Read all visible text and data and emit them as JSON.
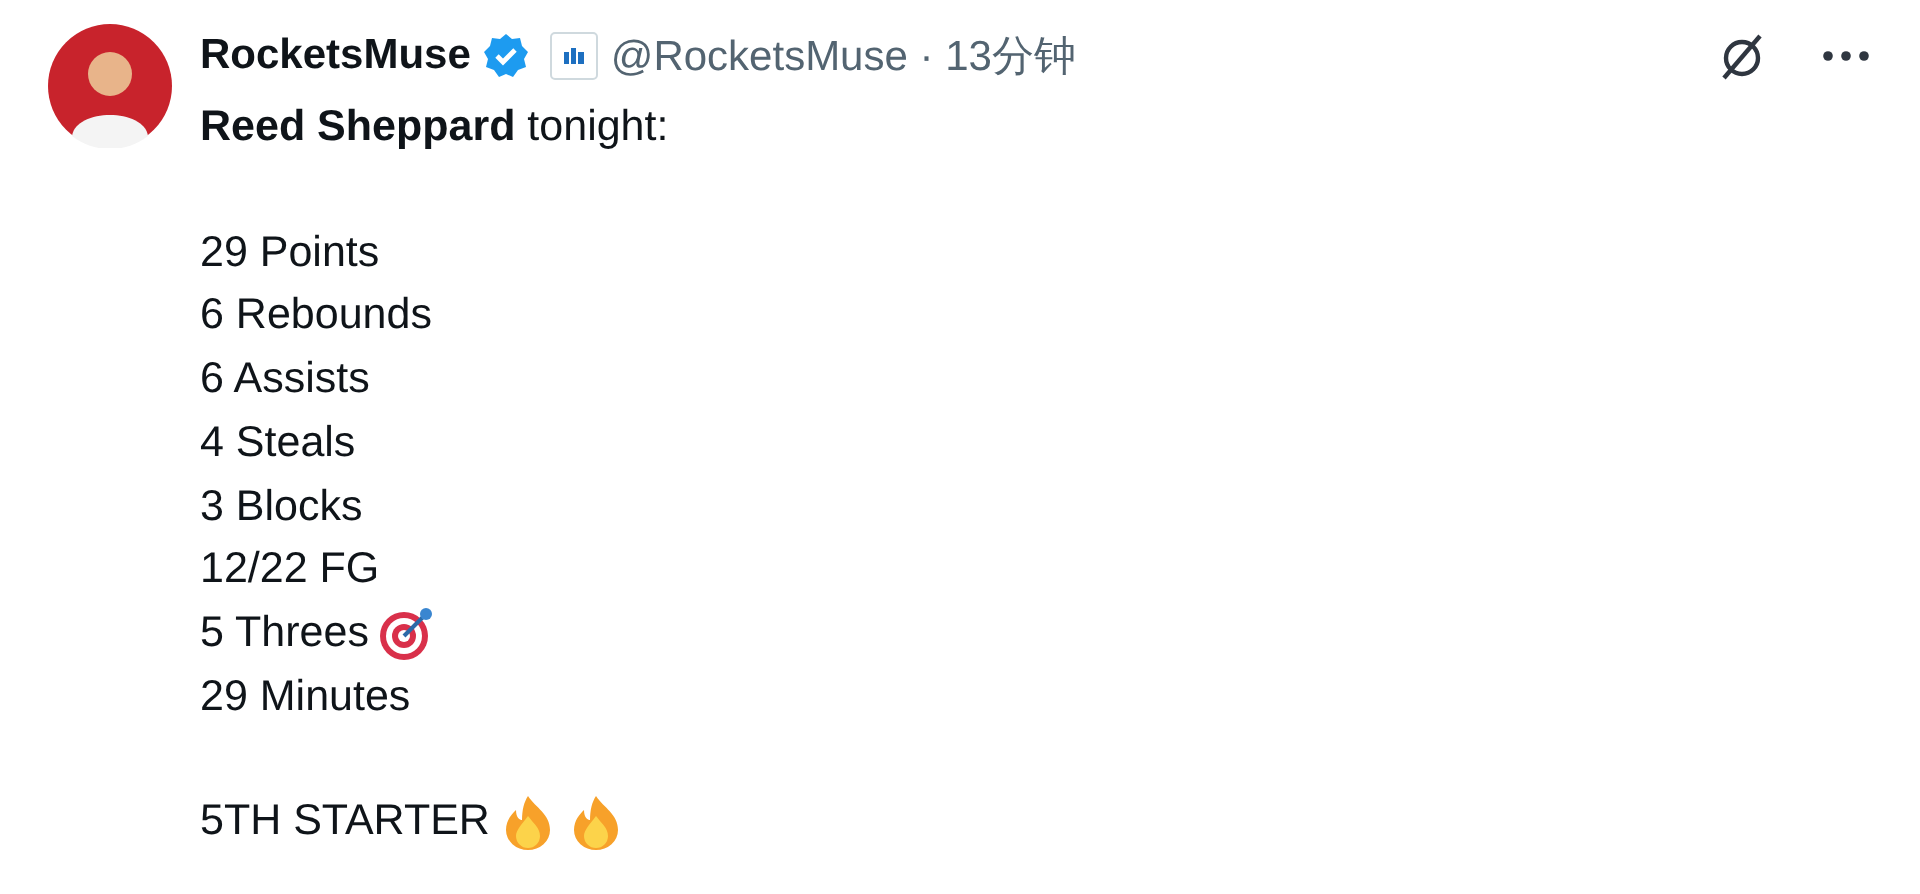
{
  "author": {
    "name": "RocketsMuse",
    "verified": true,
    "handle": "@RocketsMuse",
    "separator": "·",
    "time": "13分钟"
  },
  "intro": {
    "text": "**Reed Sheppard** tonight:"
  },
  "stats": [
    {
      "text": "29 Points"
    },
    {
      "text": "6 Rebounds"
    },
    {
      "text": "6 Assists"
    },
    {
      "text": "4 Steals"
    },
    {
      "text": "3 Blocks"
    },
    {
      "text": "12/22 FG"
    },
    {
      "text": "5 Threes",
      "emojis": [
        {
          "kind": "target"
        }
      ]
    },
    {
      "text": "29 Minutes"
    }
  ],
  "closing": {
    "text": "5TH STARTER",
    "emojis": [
      {
        "kind": "fire"
      },
      {
        "kind": "fire"
      }
    ]
  }
}
